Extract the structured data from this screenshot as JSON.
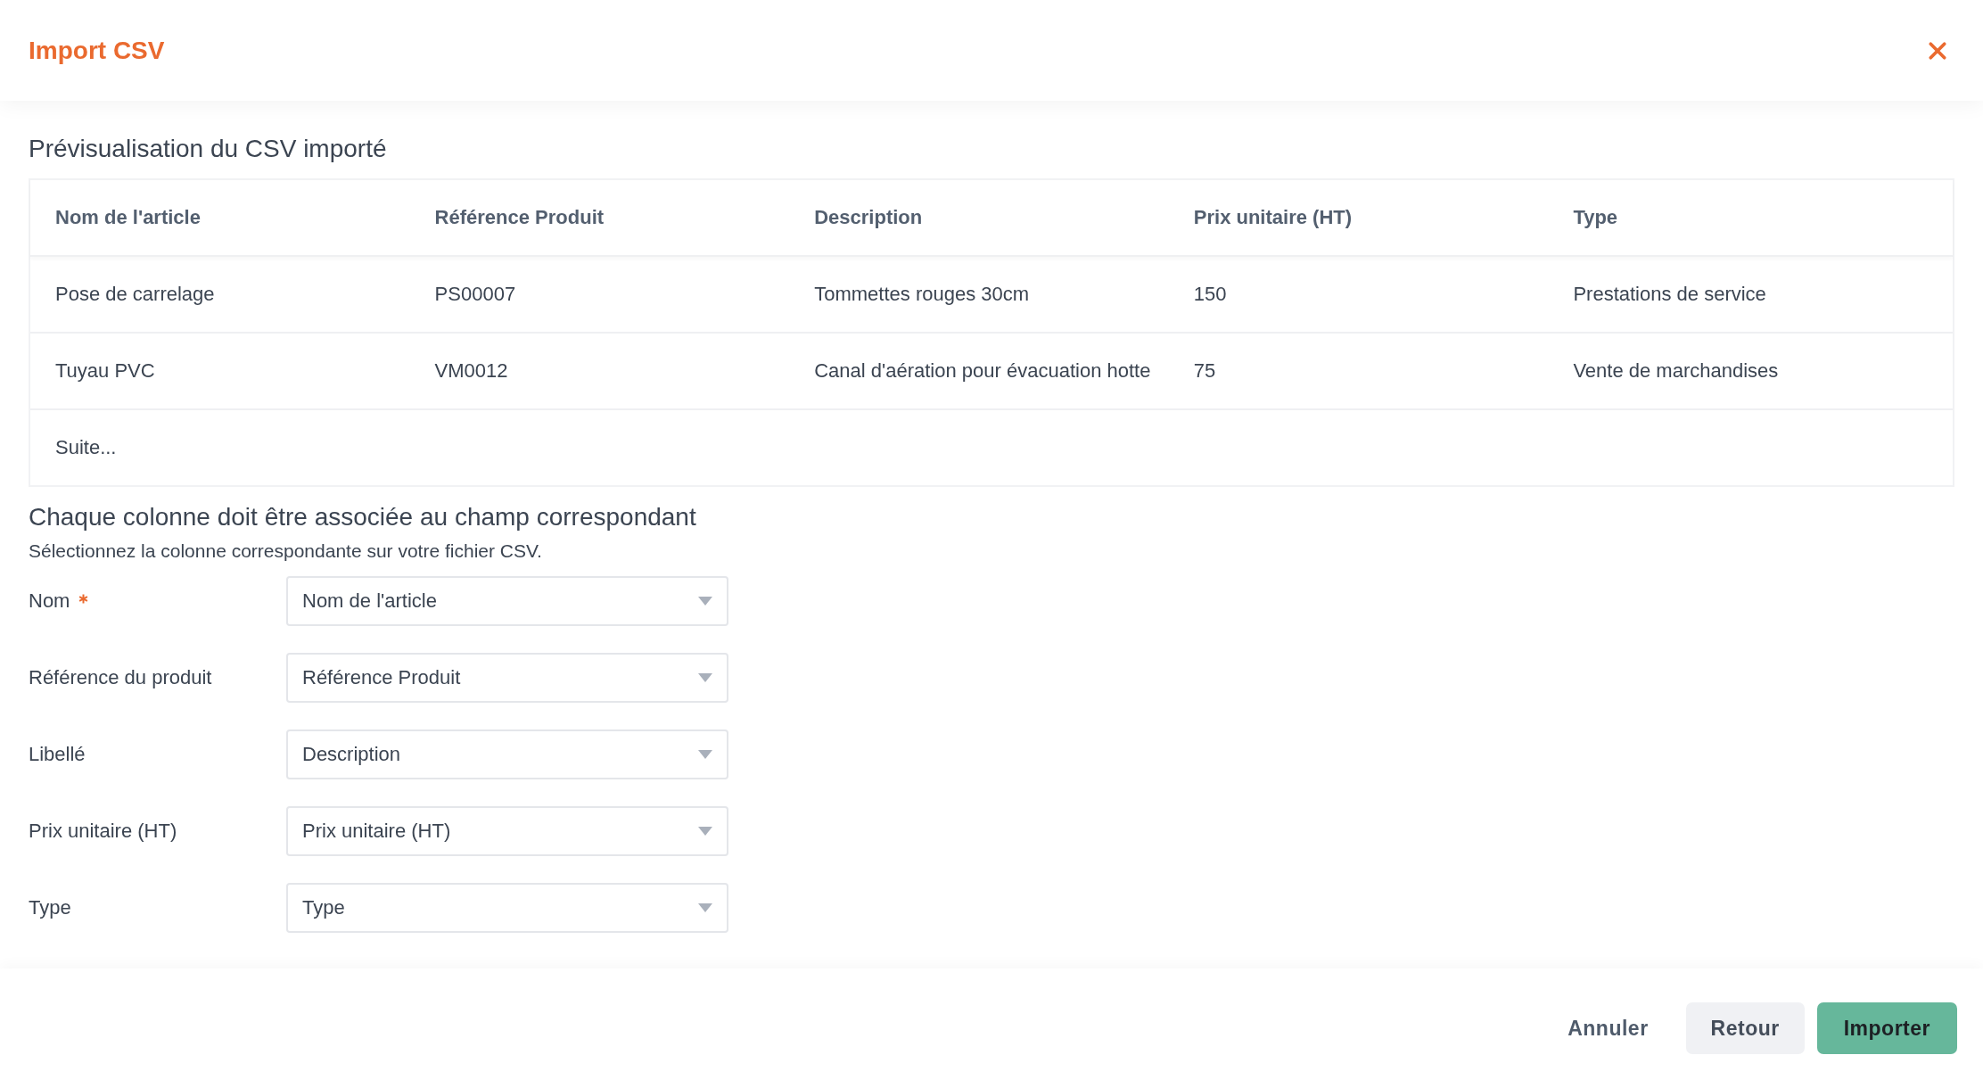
{
  "window": {
    "title": "Import CSV"
  },
  "preview": {
    "heading": "Prévisualisation du CSV importé",
    "columns": [
      "Nom de l'article",
      "Référence Produit",
      "Description",
      "Prix unitaire (HT)",
      "Type"
    ],
    "rows": [
      [
        "Pose de carrelage",
        "PS00007",
        "Tommettes rouges 30cm",
        "150",
        "Prestations de service"
      ],
      [
        "Tuyau PVC",
        "VM0012",
        "Canal d'aération pour évacuation hotte",
        "75",
        "Vente de marchandises"
      ]
    ],
    "more": "Suite..."
  },
  "mapping": {
    "heading": "Chaque colonne doit être associée au champ correspondant",
    "hint": "Sélectionnez la colonne correspondante sur votre fichier CSV.",
    "fields": [
      {
        "label": "Nom",
        "required": true,
        "value": "Nom de l'article"
      },
      {
        "label": "Référence du produit",
        "required": false,
        "value": "Référence Produit"
      },
      {
        "label": "Libellé",
        "required": false,
        "value": "Description"
      },
      {
        "label": "Prix unitaire (HT)",
        "required": false,
        "value": "Prix unitaire (HT)"
      },
      {
        "label": "Type",
        "required": false,
        "value": "Type"
      }
    ]
  },
  "buttons": [
    {
      "label": "Annuler",
      "kind": "text"
    },
    {
      "label": "Retour",
      "kind": "secondary"
    },
    {
      "label": "Importer",
      "kind": "primary"
    }
  ]
}
